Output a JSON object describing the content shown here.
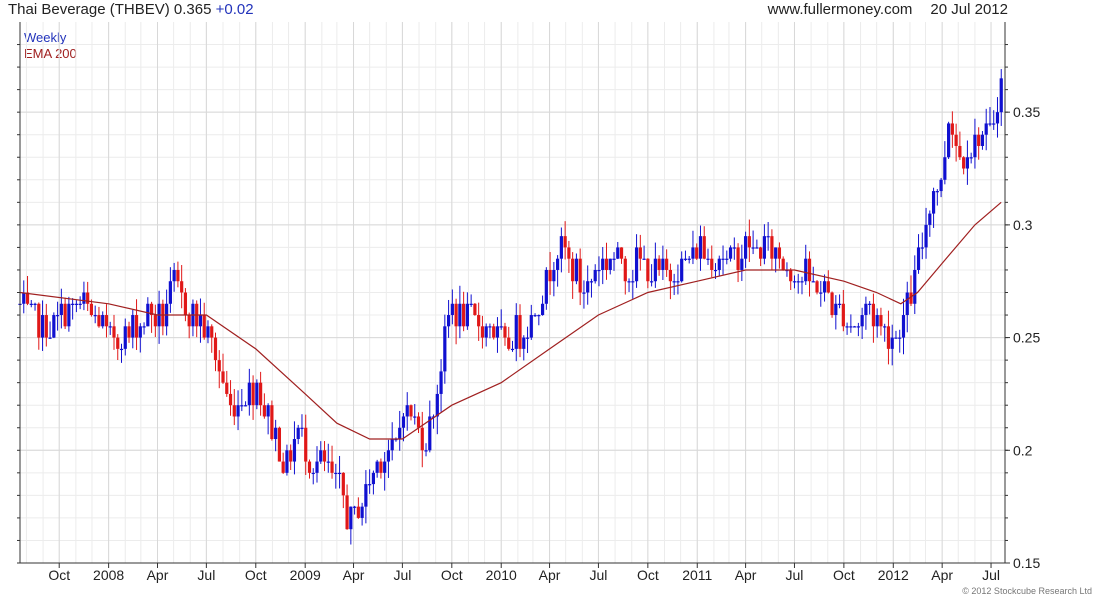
{
  "header": {
    "title": "Thai Beverage (THBEV) 0.365",
    "change": "+0.02",
    "site": "www.fullermoney.com",
    "date": "20 Jul 2012"
  },
  "legend": {
    "period": "Weekly",
    "indicator": "EMA 200"
  },
  "copyright": "© 2012 Stockcube Research Ltd",
  "colors": {
    "up": "#1010d0",
    "down": "#e01818",
    "ema": "#a02020",
    "grid": "#d8d8d8",
    "axis": "#333333"
  },
  "chart_data": {
    "type": "candlestick",
    "title": "Thai Beverage (THBEV)",
    "last": 0.365,
    "change": 0.02,
    "frequency": "Weekly",
    "ylim": [
      0.15,
      0.39
    ],
    "y_ticks": [
      0.15,
      0.2,
      0.25,
      0.3,
      0.35
    ],
    "y_tick_labels": [
      "0.15",
      "0.2",
      "0.25",
      "0.3",
      "0.35"
    ],
    "x_range": [
      "2007-07-20",
      "2012-07-27"
    ],
    "x_ticks": [
      {
        "date": "2007-10-01",
        "label": "Oct"
      },
      {
        "date": "2008-01-01",
        "label": "2008"
      },
      {
        "date": "2008-04-01",
        "label": "Apr"
      },
      {
        "date": "2008-07-01",
        "label": "Jul"
      },
      {
        "date": "2008-10-01",
        "label": "Oct"
      },
      {
        "date": "2009-01-01",
        "label": "2009"
      },
      {
        "date": "2009-04-01",
        "label": "Apr"
      },
      {
        "date": "2009-07-01",
        "label": "Jul"
      },
      {
        "date": "2009-10-01",
        "label": "Oct"
      },
      {
        "date": "2010-01-01",
        "label": "2010"
      },
      {
        "date": "2010-04-01",
        "label": "Apr"
      },
      {
        "date": "2010-07-01",
        "label": "Jul"
      },
      {
        "date": "2010-10-01",
        "label": "Oct"
      },
      {
        "date": "2011-01-01",
        "label": "2011"
      },
      {
        "date": "2011-04-01",
        "label": "Apr"
      },
      {
        "date": "2011-07-01",
        "label": "Jul"
      },
      {
        "date": "2011-10-01",
        "label": "Oct"
      },
      {
        "date": "2012-01-01",
        "label": "2012"
      },
      {
        "date": "2012-04-01",
        "label": "Apr"
      },
      {
        "date": "2012-07-01",
        "label": "Jul"
      }
    ],
    "close_path": [
      [
        "2007-07-20",
        0.265
      ],
      [
        "2007-09-01",
        0.255
      ],
      [
        "2007-10-15",
        0.26
      ],
      [
        "2007-11-20",
        0.265
      ],
      [
        "2008-01-01",
        0.25
      ],
      [
        "2008-02-01",
        0.25
      ],
      [
        "2008-03-10",
        0.26
      ],
      [
        "2008-04-10",
        0.26
      ],
      [
        "2008-05-01",
        0.275
      ],
      [
        "2008-06-01",
        0.26
      ],
      [
        "2008-07-01",
        0.255
      ],
      [
        "2008-07-20",
        0.24
      ],
      [
        "2008-08-10",
        0.22
      ],
      [
        "2008-09-10",
        0.225
      ],
      [
        "2008-10-01",
        0.23
      ],
      [
        "2008-11-01",
        0.21
      ],
      [
        "2008-11-25",
        0.19
      ],
      [
        "2008-12-15",
        0.21
      ],
      [
        "2009-01-10",
        0.195
      ],
      [
        "2009-02-01",
        0.195
      ],
      [
        "2009-03-01",
        0.185
      ],
      [
        "2009-03-25",
        0.17
      ],
      [
        "2009-04-15",
        0.175
      ],
      [
        "2009-05-10",
        0.19
      ],
      [
        "2009-06-01",
        0.2
      ],
      [
        "2009-06-20",
        0.2
      ],
      [
        "2009-07-01",
        0.22
      ],
      [
        "2009-07-20",
        0.215
      ],
      [
        "2009-08-10",
        0.205
      ],
      [
        "2009-08-30",
        0.22
      ],
      [
        "2009-09-15",
        0.245
      ],
      [
        "2009-10-01",
        0.265
      ],
      [
        "2009-10-20",
        0.26
      ],
      [
        "2009-11-15",
        0.255
      ],
      [
        "2009-12-15",
        0.255
      ],
      [
        "2010-01-10",
        0.245
      ],
      [
        "2010-02-10",
        0.255
      ],
      [
        "2010-03-01",
        0.26
      ],
      [
        "2010-03-20",
        0.27
      ],
      [
        "2010-04-05",
        0.285
      ],
      [
        "2010-04-25",
        0.29
      ],
      [
        "2010-05-15",
        0.28
      ],
      [
        "2010-06-05",
        0.27
      ],
      [
        "2010-06-25",
        0.28
      ],
      [
        "2010-07-15",
        0.285
      ],
      [
        "2010-08-10",
        0.285
      ],
      [
        "2010-09-01",
        0.28
      ],
      [
        "2010-09-25",
        0.285
      ],
      [
        "2010-10-20",
        0.275
      ],
      [
        "2010-11-15",
        0.28
      ],
      [
        "2010-12-10",
        0.285
      ],
      [
        "2011-01-10",
        0.29
      ],
      [
        "2011-02-01",
        0.285
      ],
      [
        "2011-03-01",
        0.285
      ],
      [
        "2011-04-01",
        0.29
      ],
      [
        "2011-05-01",
        0.29
      ],
      [
        "2011-06-01",
        0.285
      ],
      [
        "2011-07-01",
        0.28
      ],
      [
        "2011-08-01",
        0.275
      ],
      [
        "2011-09-01",
        0.27
      ],
      [
        "2011-09-25",
        0.26
      ],
      [
        "2011-10-20",
        0.255
      ],
      [
        "2011-11-15",
        0.265
      ],
      [
        "2011-12-10",
        0.255
      ],
      [
        "2012-01-01",
        0.25
      ],
      [
        "2012-01-20",
        0.26
      ],
      [
        "2012-02-10",
        0.275
      ],
      [
        "2012-02-25",
        0.295
      ],
      [
        "2012-03-15",
        0.315
      ],
      [
        "2012-04-01",
        0.32
      ],
      [
        "2012-04-15",
        0.35
      ],
      [
        "2012-05-01",
        0.33
      ],
      [
        "2012-05-20",
        0.335
      ],
      [
        "2012-06-10",
        0.34
      ],
      [
        "2012-07-01",
        0.34
      ],
      [
        "2012-07-20",
        0.365
      ]
    ],
    "ema200": [
      [
        "2007-07-20",
        0.27
      ],
      [
        "2008-01-01",
        0.265
      ],
      [
        "2008-04-01",
        0.26
      ],
      [
        "2008-07-01",
        0.26
      ],
      [
        "2008-10-01",
        0.245
      ],
      [
        "2009-01-01",
        0.225
      ],
      [
        "2009-03-01",
        0.212
      ],
      [
        "2009-05-01",
        0.205
      ],
      [
        "2009-07-01",
        0.205
      ],
      [
        "2009-10-01",
        0.22
      ],
      [
        "2010-01-01",
        0.23
      ],
      [
        "2010-04-01",
        0.245
      ],
      [
        "2010-07-01",
        0.26
      ],
      [
        "2010-10-01",
        0.27
      ],
      [
        "2011-01-01",
        0.275
      ],
      [
        "2011-04-01",
        0.28
      ],
      [
        "2011-07-01",
        0.28
      ],
      [
        "2011-10-01",
        0.275
      ],
      [
        "2011-12-01",
        0.27
      ],
      [
        "2012-01-15",
        0.265
      ],
      [
        "2012-02-15",
        0.27
      ],
      [
        "2012-04-01",
        0.283
      ],
      [
        "2012-06-01",
        0.3
      ],
      [
        "2012-07-20",
        0.31
      ]
    ]
  }
}
